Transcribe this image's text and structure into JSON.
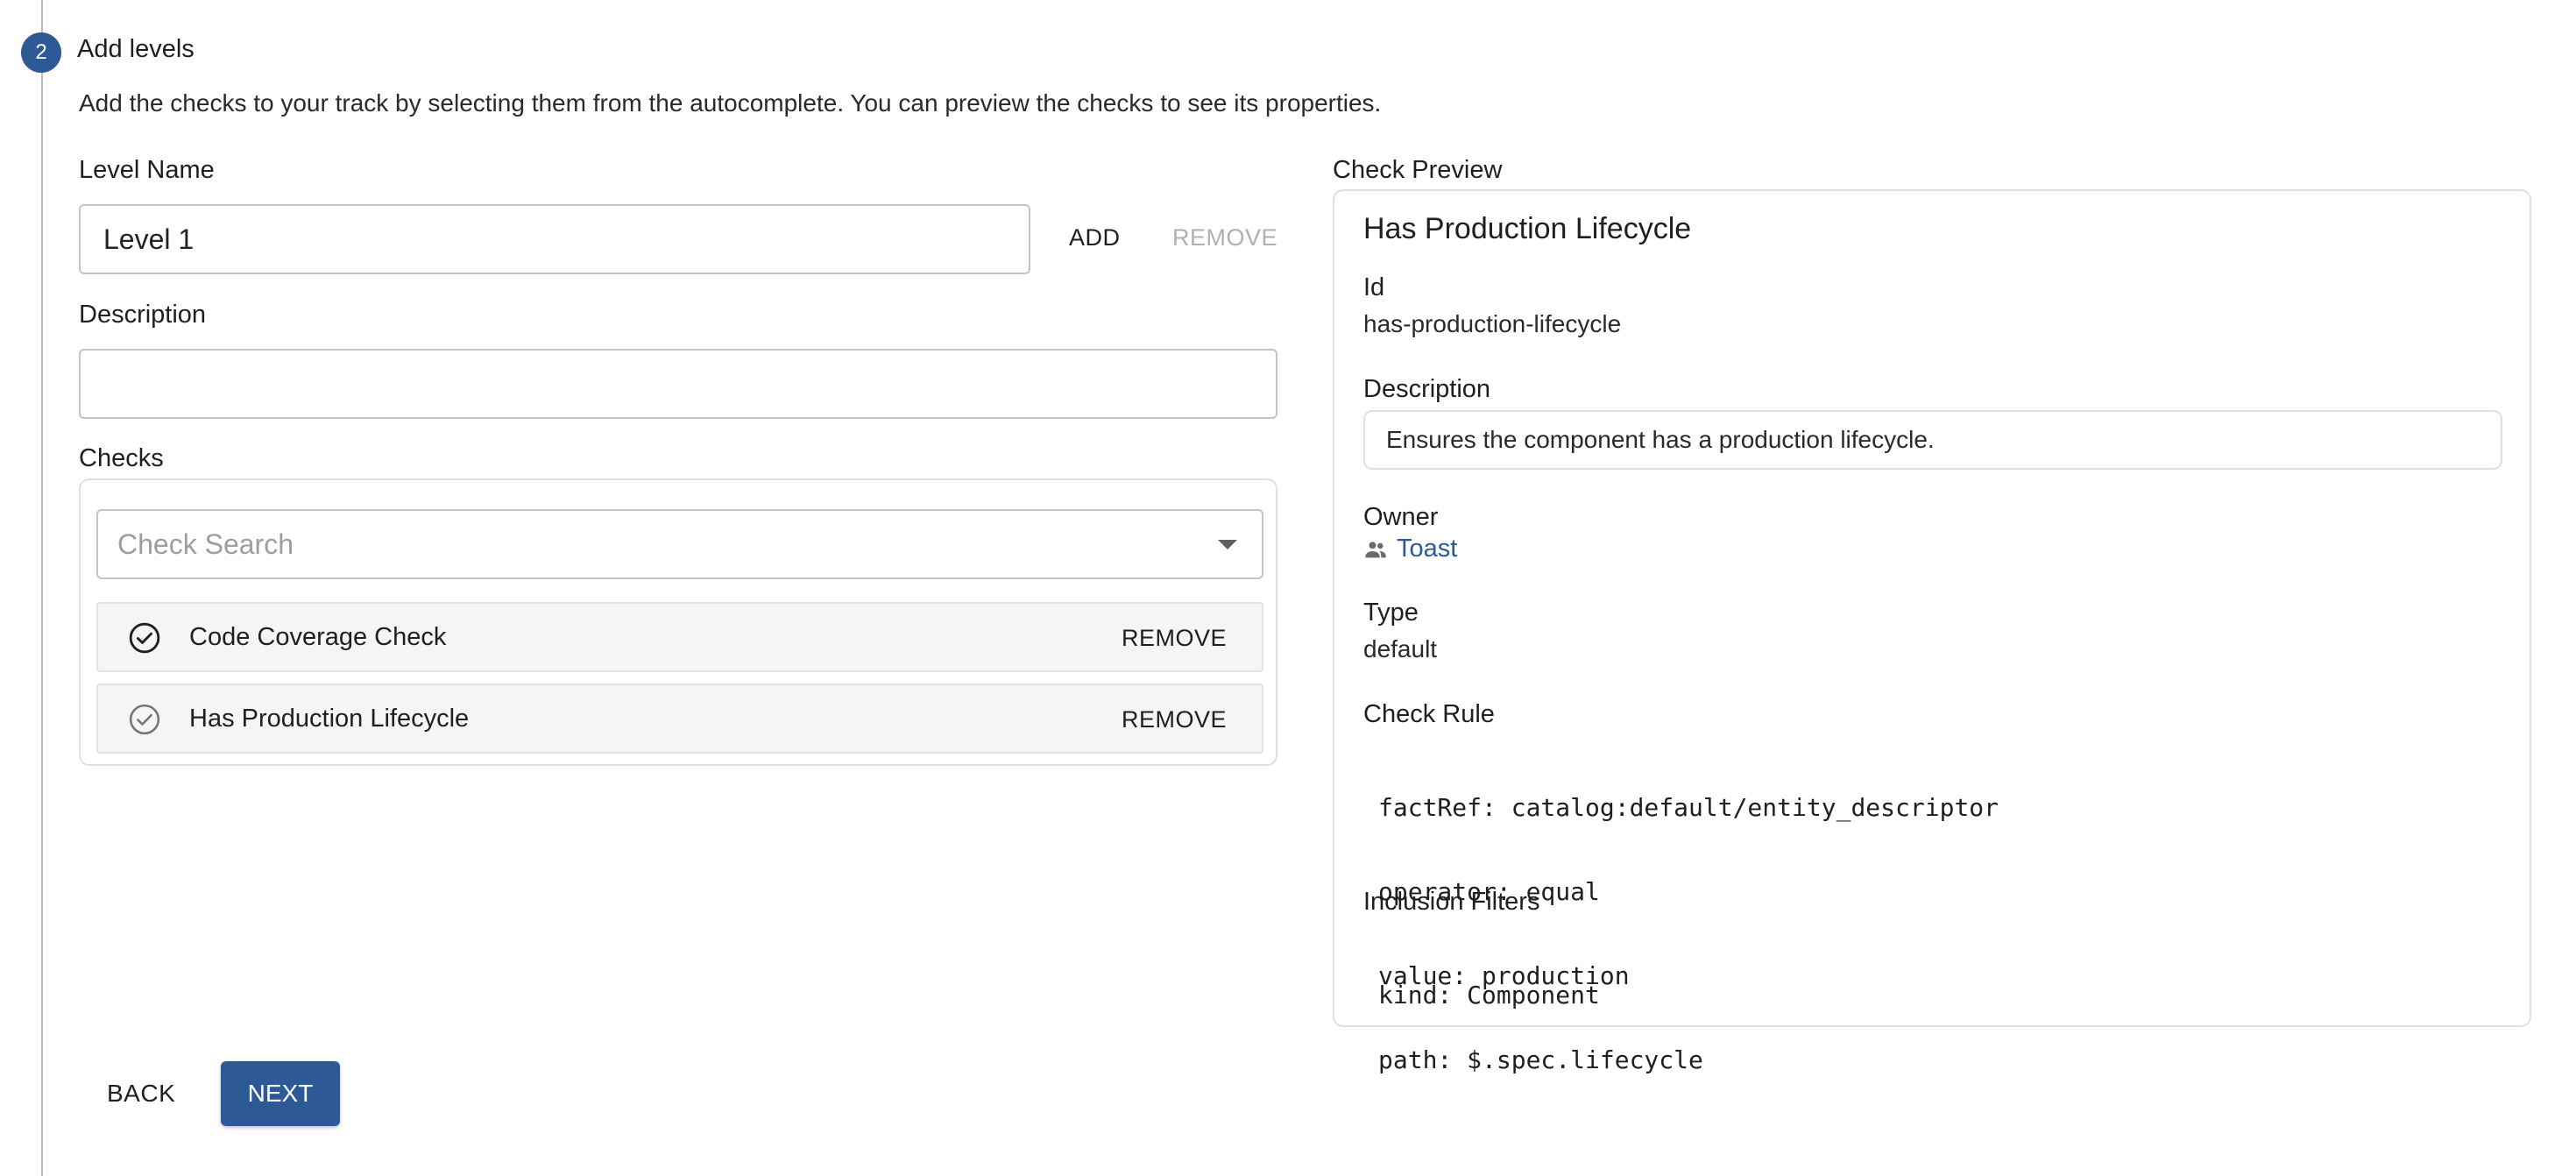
{
  "step": {
    "number": "2",
    "title": "Add levels"
  },
  "description_text": "Add the checks to your track by selecting them from the autocomplete. You can preview the checks to see its properties.",
  "level_form": {
    "level_name_label": "Level Name",
    "level_name_value": "Level 1",
    "add_label": "ADD",
    "remove_label": "REMOVE",
    "description_label": "Description",
    "description_value": "",
    "checks_label": "Checks",
    "check_search_placeholder": "Check Search"
  },
  "checks": [
    {
      "name": "Code Coverage Check",
      "remove_label": "REMOVE"
    },
    {
      "name": "Has Production Lifecycle",
      "remove_label": "REMOVE"
    }
  ],
  "preview": {
    "label": "Check Preview",
    "title": "Has Production Lifecycle",
    "id_label": "Id",
    "id_value": "has-production-lifecycle",
    "description_label": "Description",
    "description_value": "Ensures the component has a production lifecycle.",
    "owner_label": "Owner",
    "owner_value": "Toast",
    "type_label": "Type",
    "type_value": "default",
    "rule_label": "Check Rule",
    "rule_lines": [
      "factRef: catalog:default/entity_descriptor",
      "operator: equal",
      "value: production",
      "path: $.spec.lifecycle"
    ],
    "filters_label": "Inclusion Filters",
    "filters_lines": [
      "kind: Component"
    ]
  },
  "nav": {
    "back_label": "BACK",
    "next_label": "NEXT"
  },
  "colors": {
    "primary": "#2d5a96",
    "disabled_text": "#b0b0b0",
    "row_bg": "#f5f5f5"
  }
}
